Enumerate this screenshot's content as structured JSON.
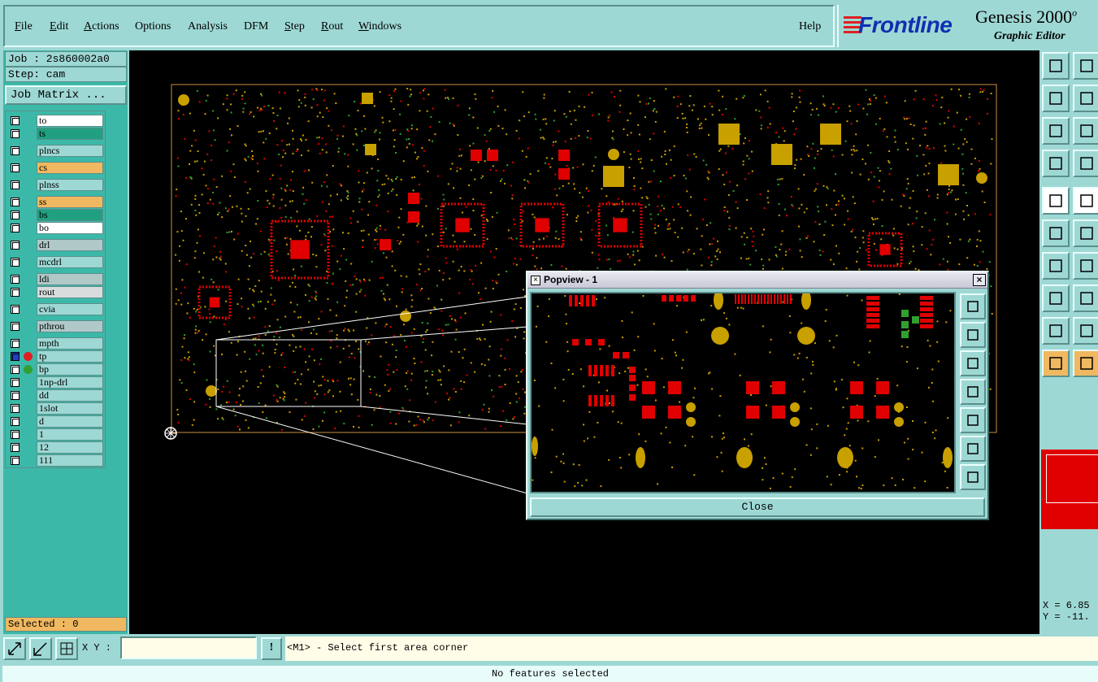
{
  "menu": {
    "items": [
      "File",
      "Edit",
      "Actions",
      "Options",
      "Analysis",
      "DFM",
      "Step",
      "Rout",
      "Windows"
    ],
    "help": "Help"
  },
  "logo": {
    "brand": "Frontline",
    "product": "Genesis 2000",
    "product_suffix": "o",
    "subtitle": "Graphic Editor"
  },
  "job": {
    "job_label": "Job : 2s860002a0",
    "step_label": "Step: cam",
    "matrix_button": "Job Matrix ..."
  },
  "layers": [
    {
      "name": "to",
      "color": "#ffffff"
    },
    {
      "name": "ts",
      "color": "#20a080"
    },
    {
      "name": "plncs",
      "color": "#9ed8d4"
    },
    {
      "name": "cs",
      "color": "#f0b860"
    },
    {
      "name": "plnss",
      "color": "#9ed8d4"
    },
    {
      "name": "ss",
      "color": "#f0b860"
    },
    {
      "name": "bs",
      "color": "#20a080"
    },
    {
      "name": "bo",
      "color": "#ffffff"
    },
    {
      "name": "drl",
      "color": "#b0c8c8"
    },
    {
      "name": "mcdrl",
      "color": "#9ed8d4"
    },
    {
      "name": "ldi",
      "color": "#b0c8c8"
    },
    {
      "name": "rout",
      "color": "#d8dcdc"
    },
    {
      "name": "cvia",
      "color": "#9ed8d4"
    },
    {
      "name": "pthrou",
      "color": "#b0c8c8"
    },
    {
      "name": "mpth",
      "color": "#9ed8d4"
    },
    {
      "name": "tp",
      "color": "#9ed8d4"
    },
    {
      "name": "bp",
      "color": "#9ed8d4"
    },
    {
      "name": "1np-drl",
      "color": "#9ed8d4"
    },
    {
      "name": "dd",
      "color": "#9ed8d4"
    },
    {
      "name": "1slot",
      "color": "#9ed8d4"
    },
    {
      "name": "d",
      "color": "#9ed8d4"
    },
    {
      "name": "1",
      "color": "#9ed8d4"
    },
    {
      "name": "12",
      "color": "#9ed8d4"
    },
    {
      "name": "111",
      "color": "#9ed8d4"
    }
  ],
  "selected": "Selected : 0",
  "coords": {
    "x": "X = 6.85",
    "y": "Y = -11."
  },
  "status": {
    "xy_label": "X Y :",
    "xy_value": "",
    "bang": "!",
    "prompt": "<M1> - Select first area corner",
    "bottom": "No features selected"
  },
  "popview": {
    "title": "Popview - 1",
    "close": "Close"
  },
  "colors": {
    "pad_red": "#e00000",
    "pad_gold": "#c8a000",
    "pad_green": "#30a030",
    "panel": "#9ed8d4",
    "panel_dark": "#3cb8a8"
  }
}
